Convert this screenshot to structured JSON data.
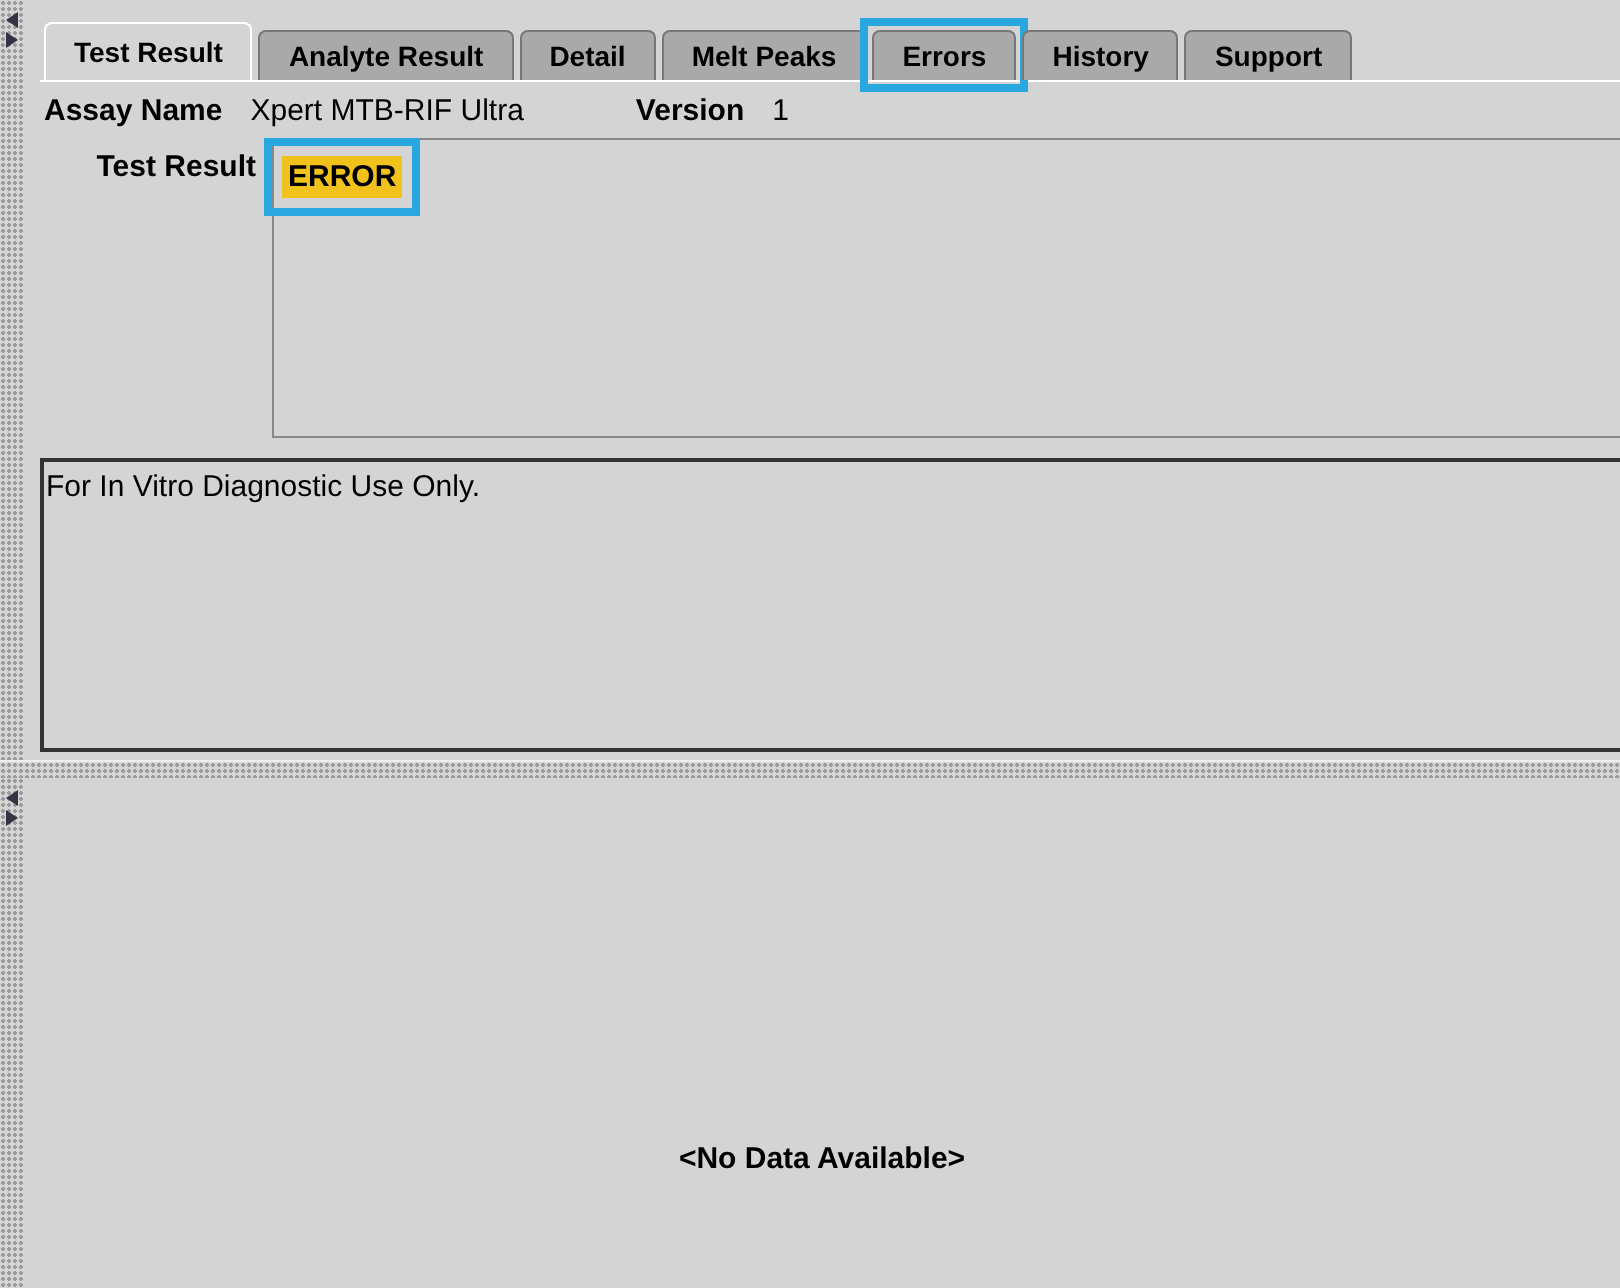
{
  "tabs": [
    {
      "label": "Test Result",
      "selected": true,
      "highlighted": false
    },
    {
      "label": "Analyte Result",
      "selected": false,
      "highlighted": false
    },
    {
      "label": "Detail",
      "selected": false,
      "highlighted": false
    },
    {
      "label": "Melt Peaks",
      "selected": false,
      "highlighted": false
    },
    {
      "label": "Errors",
      "selected": false,
      "highlighted": true
    },
    {
      "label": "History",
      "selected": false,
      "highlighted": false
    },
    {
      "label": "Support",
      "selected": false,
      "highlighted": false
    }
  ],
  "assay": {
    "label": "Assay Name",
    "value": "Xpert MTB-RIF Ultra",
    "version_label": "Version",
    "version": "1"
  },
  "test_result": {
    "label": "Test Result",
    "value": "ERROR",
    "highlighted": true
  },
  "notes": "For In Vitro Diagnostic Use Only.",
  "bottom_pane": {
    "message": "<No Data Available>"
  }
}
